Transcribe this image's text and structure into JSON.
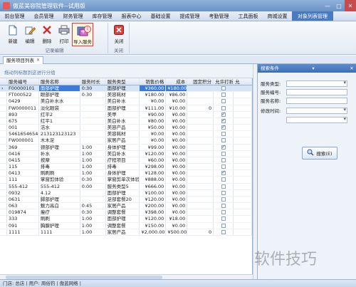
{
  "window": {
    "title": "傲蓝美容院管理软件--试用版",
    "controls": [
      "—",
      "□",
      "✕"
    ]
  },
  "menu": {
    "items": [
      "前台管理",
      "会员管理",
      "财务管理",
      "库存管理",
      "报表中心",
      "基础设置",
      "提成管理",
      "考勤管理",
      "工具面板",
      "商城设置",
      "对象列表管理"
    ],
    "active_index": 10
  },
  "ribbon": {
    "group_records": "记录编辑",
    "group_close": "关闭",
    "buttons": {
      "new": "新建",
      "edit": "编辑",
      "delete": "删除",
      "print": "打印",
      "import": "导入服务",
      "close": "关闭"
    },
    "badge": "①"
  },
  "tabs": {
    "active": "服务项目列表",
    "close": "✕"
  },
  "group_hint": "拖动列标题到这进行分组",
  "grid": {
    "columns": [
      "",
      "服务编号",
      "服务名称",
      "服务时长",
      "服务类型",
      "销售价格",
      "成本",
      "固定积分",
      "允许打折",
      "允"
    ],
    "rows": [
      [
        "›",
        "F00000101",
        "面部护理",
        "0:30",
        "面部护理",
        "¥360.00",
        "¥180.00",
        "",
        "off",
        ""
      ],
      [
        "",
        "FT000522",
        "眼部护理",
        "0:30",
        "美容耗材",
        "¥180.00",
        "¥86.00",
        "",
        "off",
        ""
      ],
      [
        "",
        "0429",
        "美白补水水",
        "",
        "美白补水",
        "¥0.00",
        "¥0.00",
        "",
        "off",
        ""
      ],
      [
        "",
        "FW0000011",
        "淡化眼袋",
        "",
        "面部护理",
        "¥111.00",
        "¥10.00",
        "0",
        "off",
        ""
      ],
      [
        "",
        "893",
        "红平2",
        "",
        "美甲",
        "¥90.00",
        "¥0.00",
        "",
        "on",
        ""
      ],
      [
        "",
        "675",
        "红平1",
        "",
        "美白补水",
        "¥80.00",
        "¥0.00",
        "",
        "on",
        ""
      ],
      [
        "",
        "001",
        "洁水",
        "",
        "美容产品",
        "¥50.00",
        "¥0.00",
        "",
        "on",
        ""
      ],
      [
        "",
        "54616546546",
        "213123123123",
        "",
        "美容耗材",
        "¥0.00",
        "¥0.00",
        "",
        "off",
        ""
      ],
      [
        "",
        "FW000001",
        "木木足",
        "",
        "家居产品",
        "¥0.00",
        "¥0.00",
        "",
        "off",
        ""
      ],
      [
        "",
        "369",
        "颈部护理",
        "1:00",
        "身体护理",
        "¥99.00",
        "¥0.00",
        "",
        "on",
        ""
      ],
      [
        "",
        "0416",
        "补水",
        "1:00",
        "美白补水",
        "¥120.00",
        "¥0.00",
        "",
        "off",
        ""
      ],
      [
        "",
        "0415",
        "按摩",
        "1:00",
        "疗程项目",
        "¥60.00",
        "¥0.00",
        "",
        "off",
        ""
      ],
      [
        "",
        "115",
        "排毒",
        "1:00",
        "排毒",
        "¥298.00",
        "¥0.00",
        "",
        "off",
        ""
      ],
      [
        "",
        "0413",
        "刷刷刷",
        "1:00",
        "身体护理",
        "¥128.00",
        "¥0.00",
        "",
        "on",
        ""
      ],
      [
        "",
        "111",
        "掌窗剪体验",
        "0:30",
        "掌窗剪单次体验",
        "¥888.00",
        "¥0.00",
        "",
        "off",
        ""
      ],
      [
        "",
        "555-412",
        "555-412",
        "0:00",
        "服务类型5",
        "¥666.00",
        "¥0.00",
        "",
        "off",
        ""
      ],
      [
        "",
        "0932",
        "4.12",
        "",
        "面部护理",
        "¥100.00",
        "¥0.00",
        "",
        "off",
        ""
      ],
      [
        "",
        "0631",
        "脚部护理",
        "",
        "足部套餐20",
        "¥120.00",
        "¥0.00",
        "",
        "off",
        ""
      ],
      [
        "",
        "063",
        "魅力高白",
        "0:45",
        "家居产品",
        "¥200.00",
        "¥0.00",
        "",
        "off",
        ""
      ],
      [
        "",
        "019874",
        "瘦疗",
        "0:30",
        "调整套餐",
        "¥398.00",
        "¥0.00",
        "",
        "off",
        ""
      ],
      [
        "",
        "333",
        "刷刷",
        "1:00",
        "面部护理",
        "¥120.00",
        "¥18.00",
        "",
        "off",
        ""
      ],
      [
        "",
        "091",
        "胸腺护理",
        "1:00",
        "调整套餐",
        "¥150.00",
        "¥0.00",
        "",
        "off",
        ""
      ],
      [
        "",
        "1111",
        "1111",
        "1:00",
        "家居产品",
        "¥2,000.00",
        "¥500.00",
        "0",
        "off",
        ""
      ]
    ]
  },
  "search_panel": {
    "title": "搜索条件",
    "pin": "▾",
    "close": "✕",
    "fields": [
      {
        "label": "服务类型:",
        "type": "select"
      },
      {
        "label": "服务编号:",
        "type": "text"
      },
      {
        "label": "服务名称:",
        "type": "text"
      },
      {
        "label": "修改时间:",
        "type": "select"
      },
      {
        "label": "",
        "type": "select"
      }
    ],
    "search_button": "搜索(E)"
  },
  "statusbar": "门店: 总店 | 用户: 周俗钓 | 傲蓝网络 |",
  "watermark": "软件技巧",
  "colors": {
    "accent": "#3b6fb6",
    "highlight": "#ee3333"
  }
}
